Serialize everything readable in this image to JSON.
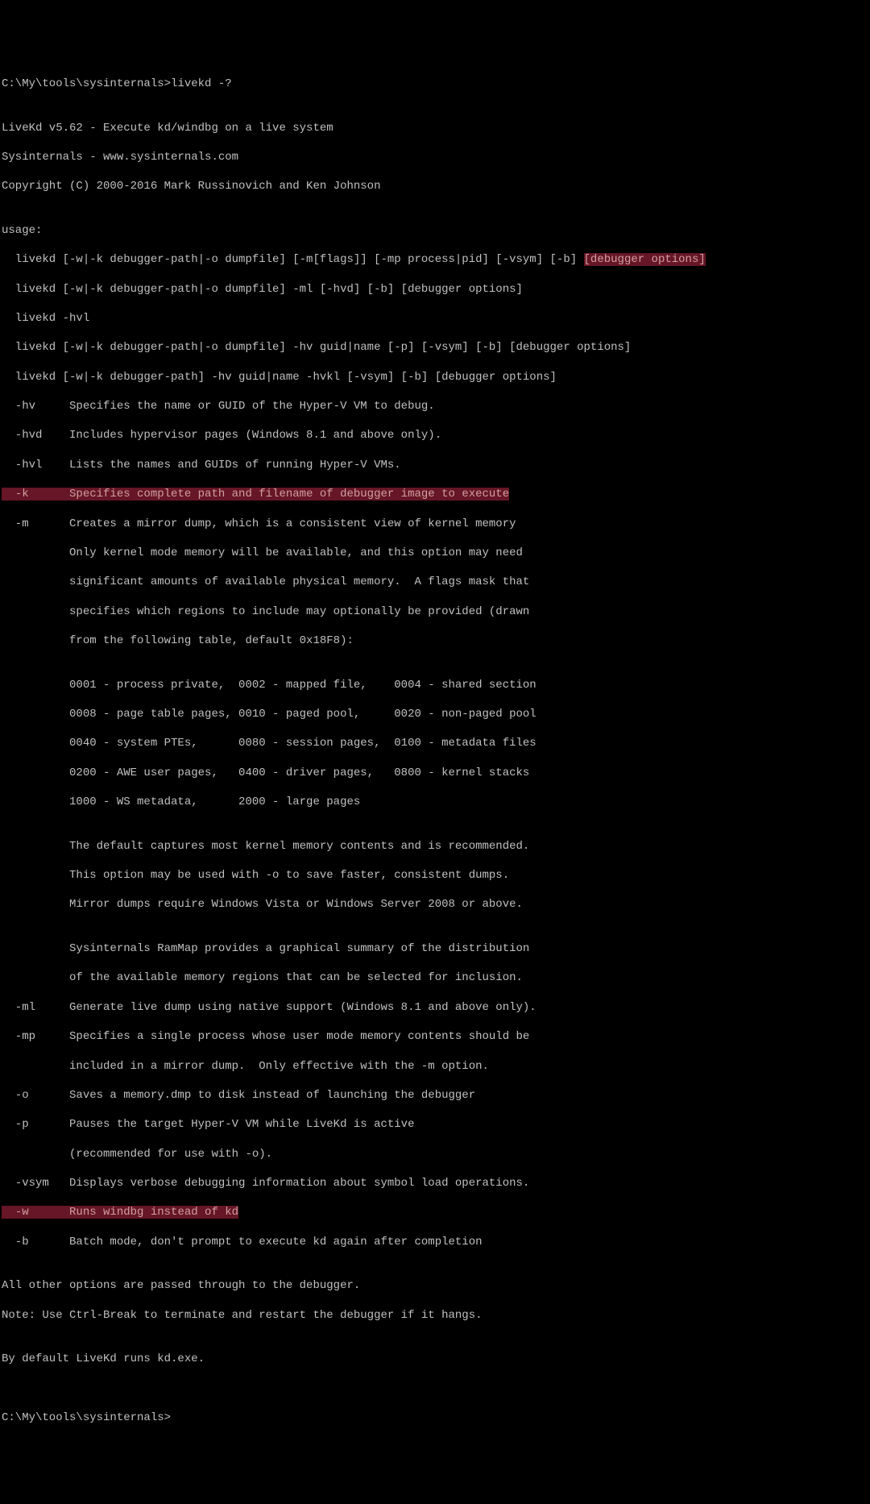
{
  "terminal": {
    "prompt1": "C:\\My\\tools\\sysinternals>",
    "command": "livekd -?",
    "blank": "",
    "header1": "LiveKd v5.62 - Execute kd/windbg on a live system",
    "header2": "Sysinternals - www.sysinternals.com",
    "header3": "Copyright (C) 2000-2016 Mark Russinovich and Ken Johnson",
    "usage_label": "usage:",
    "usage1_pre": "  livekd [-w|-k debugger-path|-o dumpfile] [-m[flags]] [-mp process|pid] [-vsym] [-b] ",
    "usage1_hl": "[debugger options]",
    "usage2": "  livekd [-w|-k debugger-path|-o dumpfile] -ml [-hvd] [-b] [debugger options]",
    "usage3": "  livekd -hvl",
    "usage4": "  livekd [-w|-k debugger-path|-o dumpfile] -hv guid|name [-p] [-vsym] [-b] [debugger options]",
    "usage5": "  livekd [-w|-k debugger-path] -hv guid|name -hvkl [-vsym] [-b] [debugger options]",
    "opt_hv": "  -hv     Specifies the name or GUID of the Hyper-V VM to debug.",
    "opt_hvd": "  -hvd    Includes hypervisor pages (Windows 8.1 and above only).",
    "opt_hvl": "  -hvl    Lists the names and GUIDs of running Hyper-V VMs.",
    "opt_k_flag": "  -k",
    "opt_k_desc": "      Specifies complete path and filename of debugger image to execute",
    "opt_m1": "  -m      Creates a mirror dump, which is a consistent view of kernel memory",
    "opt_m2": "          Only kernel mode memory will be available, and this option may need",
    "opt_m3": "          significant amounts of available physical memory.  A flags mask that",
    "opt_m4": "          specifies which regions to include may optionally be provided (drawn",
    "opt_m5": "          from the following table, default 0x18F8):",
    "flags1": "          0001 - process private,  0002 - mapped file,    0004 - shared section",
    "flags2": "          0008 - page table pages, 0010 - paged pool,     0020 - non-paged pool",
    "flags3": "          0040 - system PTEs,      0080 - session pages,  0100 - metadata files",
    "flags4": "          0200 - AWE user pages,   0400 - driver pages,   0800 - kernel stacks",
    "flags5": "          1000 - WS metadata,      2000 - large pages",
    "m_note1": "          The default captures most kernel memory contents and is recommended.",
    "m_note2": "          This option may be used with -o to save faster, consistent dumps.",
    "m_note3": "          Mirror dumps require Windows Vista or Windows Server 2008 or above.",
    "m_note4": "          Sysinternals RamMap provides a graphical summary of the distribution",
    "m_note5": "          of the available memory regions that can be selected for inclusion.",
    "opt_ml": "  -ml     Generate live dump using native support (Windows 8.1 and above only).",
    "opt_mp1": "  -mp     Specifies a single process whose user mode memory contents should be",
    "opt_mp2": "          included in a mirror dump.  Only effective with the -m option.",
    "opt_o": "  -o      Saves a memory.dmp to disk instead of launching the debugger",
    "opt_p1": "  -p      Pauses the target Hyper-V VM while LiveKd is active",
    "opt_p2": "          (recommended for use with -o).",
    "opt_vsym": "  -vsym   Displays verbose debugging information about symbol load operations.",
    "opt_w_flag": "  -w",
    "opt_w_desc": "      Runs windbg instead of kd",
    "opt_b": "  -b      Batch mode, don't prompt to execute kd again after completion",
    "footer1": "All other options are passed through to the debugger.",
    "footer2": "Note: Use Ctrl-Break to terminate and restart the debugger if it hangs.",
    "footer3": "By default LiveKd runs kd.exe.",
    "prompt2": "C:\\My\\tools\\sysinternals>"
  }
}
